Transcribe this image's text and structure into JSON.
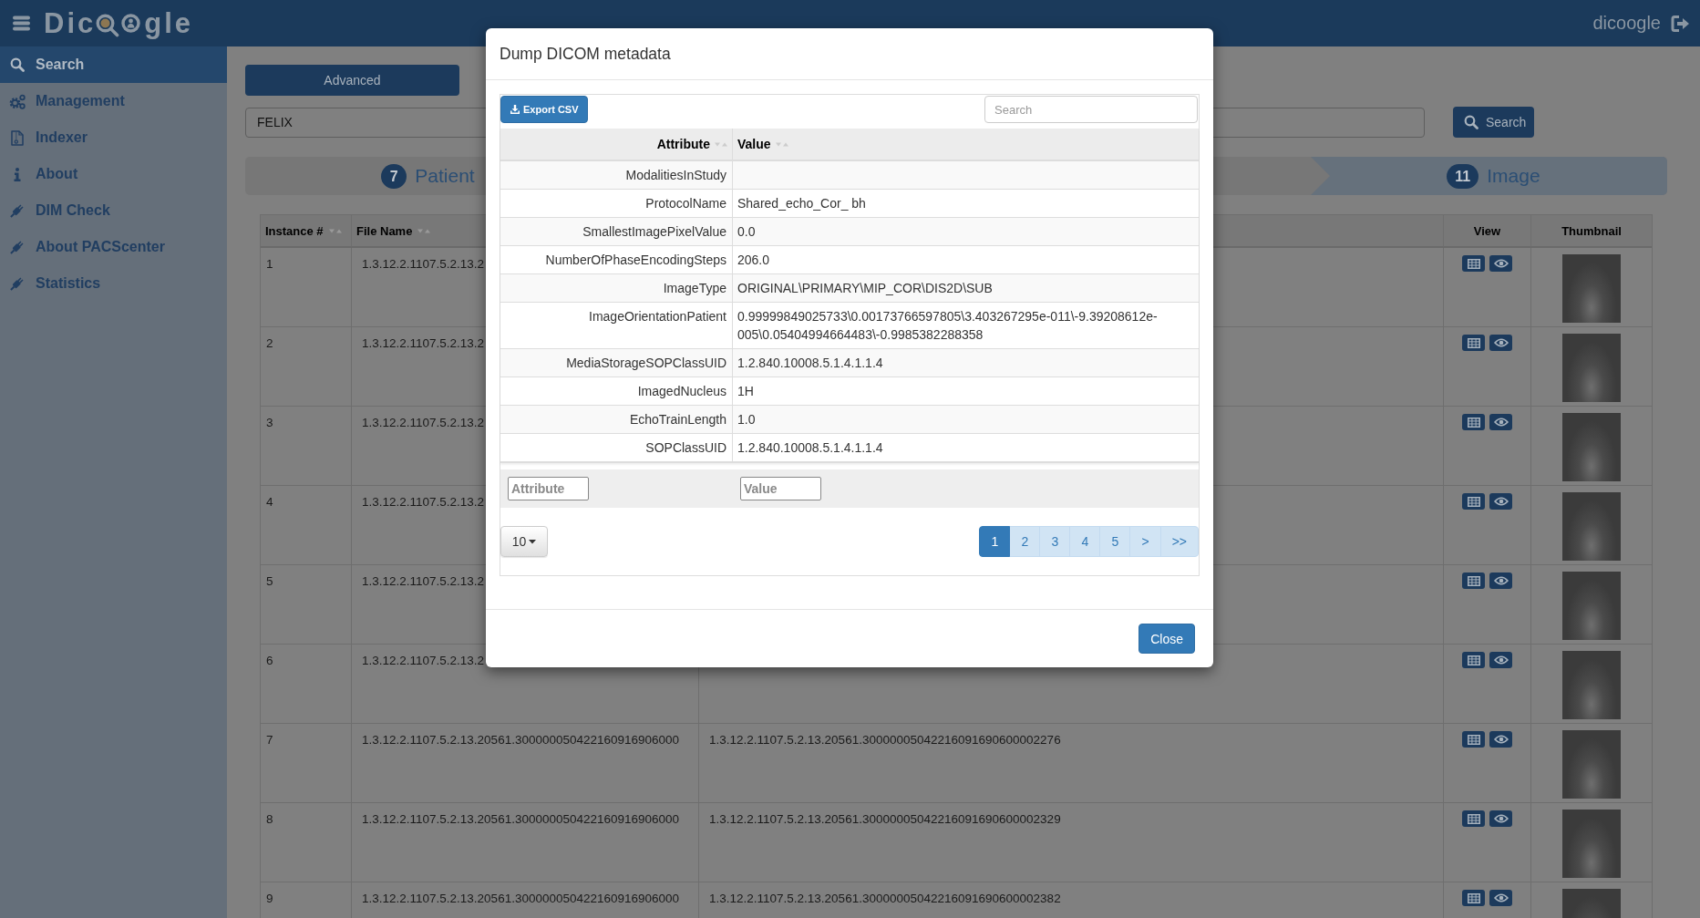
{
  "header": {
    "logo": {
      "prefix": "Dic",
      "suffix": "gle"
    },
    "user": "dicoogle"
  },
  "sidebar": {
    "items": [
      {
        "kind": "search",
        "label": "Search",
        "selected": true
      },
      {
        "kind": "gears",
        "label": "Management",
        "selected": false
      },
      {
        "kind": "document",
        "label": "Indexer",
        "selected": false
      },
      {
        "kind": "info",
        "label": "About",
        "selected": false
      },
      {
        "kind": "plug",
        "label": "DIM Check",
        "selected": false
      },
      {
        "kind": "plug",
        "label": "About PACScenter",
        "selected": false
      },
      {
        "kind": "plug",
        "label": "Statistics",
        "selected": false
      }
    ]
  },
  "search_panel": {
    "advanced_button": "Advanced",
    "query_field": {
      "value": "FELIX"
    },
    "search_button": "Search"
  },
  "steps": [
    {
      "count": "7",
      "label": "Patient",
      "selected": false
    },
    {
      "count": "11",
      "label": "Image",
      "selected": true
    }
  ],
  "results_table": {
    "columns": [
      {
        "kind": "text",
        "label": "Instance #",
        "sortable": true
      },
      {
        "kind": "text",
        "label": "File Name",
        "sortable": true
      },
      {
        "kind": "text"
      },
      {
        "kind": "view",
        "label": "View",
        "sortable": false
      },
      {
        "kind": "thumbnail",
        "label": "Thumbnail",
        "sortable": false
      }
    ],
    "rows": [
      {
        "cells": [
          "1",
          "1.3.12.2.1107.5.2.13.2"
        ]
      },
      {
        "cells": [
          "2",
          "1.3.12.2.1107.5.2.13.2"
        ]
      },
      {
        "cells": [
          "3",
          "1.3.12.2.1107.5.2.13.2"
        ]
      },
      {
        "cells": [
          "4",
          "1.3.12.2.1107.5.2.13.2"
        ]
      },
      {
        "cells": [
          "5",
          "1.3.12.2.1107.5.2.13.2"
        ]
      },
      {
        "cells": [
          "6",
          "1.3.12.2.1107.5.2.13.2"
        ]
      },
      {
        "cells": [
          "7",
          "1.3.12.2.1107.5.2.13.20561.300000050422160916906000",
          "1.3.12.2.1107.5.2.13.20561.30000005042216091690600002276"
        ]
      },
      {
        "cells": [
          "8",
          "1.3.12.2.1107.5.2.13.20561.300000050422160916906000",
          "1.3.12.2.1107.5.2.13.20561.30000005042216091690600002329"
        ]
      },
      {
        "cells": [
          "9",
          "1.3.12.2.1107.5.2.13.20561.300000050422160916906000",
          "1.3.12.2.1107.5.2.13.20561.30000005042216091690600002382"
        ]
      }
    ]
  },
  "dialog": {
    "title": "Dump DICOM metadata",
    "export_button": "Export CSV",
    "search_field": {
      "placeholder": "Search"
    },
    "columns": [
      {
        "label": "Attribute",
        "sortable": true
      },
      {
        "label": "Value",
        "sortable": true
      }
    ],
    "rows": [
      {
        "attribute": "ModalitiesInStudy"
      },
      {
        "attribute": "ProtocolName",
        "value": "Shared_echo_Cor_ bh"
      },
      {
        "attribute": "SmallestImagePixelValue",
        "value": "0.0"
      },
      {
        "attribute": "NumberOfPhaseEncodingSteps",
        "value": "206.0"
      },
      {
        "attribute": "ImageType",
        "value": "ORIGINAL\\PRIMARY\\MIP_COR\\DIS2D\\SUB"
      },
      {
        "attribute": "ImageOrientationPatient",
        "value": "0.99999849025733\\0.00173766597805\\3.403267295e-011\\-9.39208612e-005\\0.05404994664483\\-0.9985382288358"
      },
      {
        "attribute": "MediaStorageSOPClassUID",
        "value": "1.2.840.10008.5.1.4.1.1.4"
      },
      {
        "attribute": "ImagedNucleus",
        "value": "1H"
      },
      {
        "attribute": "EchoTrainLength",
        "value": "1.0"
      },
      {
        "attribute": "SOPClassUID",
        "value": "1.2.840.10008.5.1.4.1.1.4"
      }
    ],
    "filters": [
      {
        "placeholder": "Attribute"
      },
      {
        "placeholder": "Value"
      }
    ],
    "page_size": "10",
    "pages": [
      {
        "label": "1",
        "selected": true
      },
      {
        "label": "2",
        "selected": false
      },
      {
        "label": "3",
        "selected": false
      },
      {
        "label": "4",
        "selected": false
      },
      {
        "label": "5",
        "selected": false
      },
      {
        "label": ">",
        "selected": false
      },
      {
        "label": ">>",
        "selected": false
      }
    ],
    "close_button": "Close"
  }
}
